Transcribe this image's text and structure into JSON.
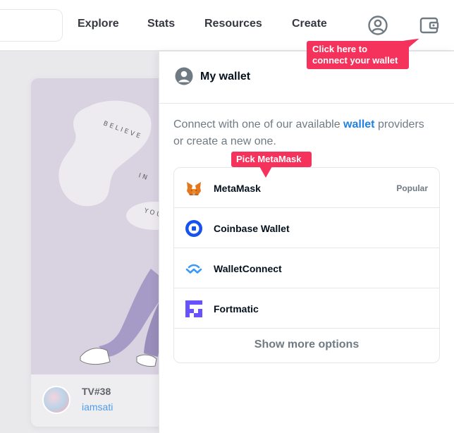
{
  "nav": {
    "links": [
      {
        "label": "Explore"
      },
      {
        "label": "Stats"
      },
      {
        "label": "Resources"
      },
      {
        "label": "Create"
      }
    ],
    "icons": [
      "account-icon",
      "wallet-icon"
    ]
  },
  "background_card": {
    "artwork_words": [
      "BELIEVE",
      "IN",
      "YOU"
    ],
    "title": "TV#38",
    "owner": "iamsati"
  },
  "wallet_panel": {
    "title": "My wallet",
    "intro_before": "Connect with one of our available ",
    "intro_link": "wallet",
    "intro_after": " providers or create a new one.",
    "wallets": [
      {
        "name": "MetaMask",
        "badge": "Popular",
        "icon": "metamask-fox-icon"
      },
      {
        "name": "Coinbase Wallet",
        "badge": "",
        "icon": "coinbase-wallet-icon"
      },
      {
        "name": "WalletConnect",
        "badge": "",
        "icon": "walletconnect-icon"
      },
      {
        "name": "Fortmatic",
        "badge": "",
        "icon": "fortmatic-icon"
      }
    ],
    "show_more": "Show more options"
  },
  "tooltips": {
    "connect_line1": "Click here to",
    "connect_line2": "connect your wallet",
    "pick": "Pick MetaMask"
  },
  "colors": {
    "accent_blue": "#2081e2",
    "tooltip_pink": "#f5325c",
    "text_dark": "#04111d",
    "text_muted": "#707a83"
  }
}
